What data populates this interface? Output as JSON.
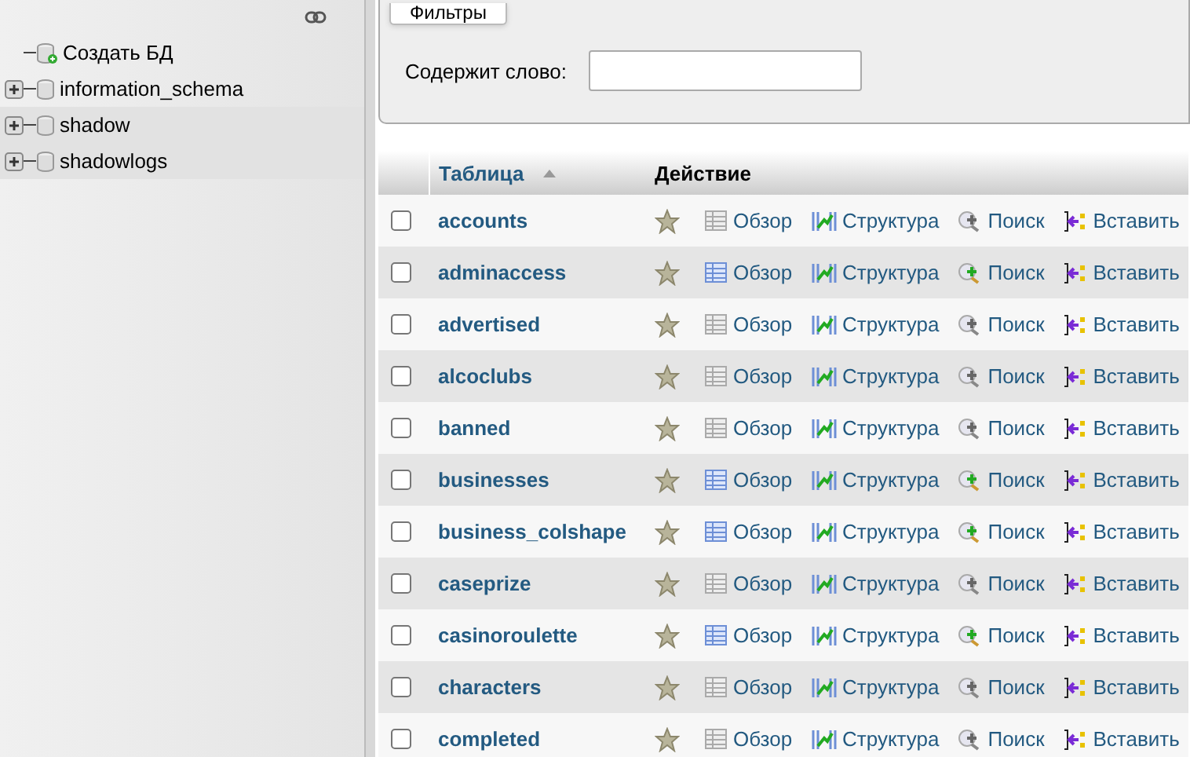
{
  "sidebar": {
    "items": [
      {
        "label": "Создать БД",
        "kind": "new",
        "expandable": false
      },
      {
        "label": "information_schema",
        "kind": "db",
        "expandable": true
      },
      {
        "label": "shadow",
        "kind": "db",
        "expandable": true
      },
      {
        "label": "shadowlogs",
        "kind": "db",
        "expandable": true
      }
    ]
  },
  "filter": {
    "button": "Фильтры",
    "label": "Содержит слово:"
  },
  "table": {
    "columns": [
      "Таблица",
      "Действие"
    ],
    "rows": [
      {
        "name": "accounts",
        "checked": false,
        "empty": true,
        "actions": [
          "Обзор",
          "Структура",
          "Поиск",
          "Вставить"
        ]
      },
      {
        "name": "adminaccess",
        "checked": false,
        "empty": false,
        "actions": [
          "Обзор",
          "Структура",
          "Поиск",
          "Вставить"
        ]
      },
      {
        "name": "advertised",
        "checked": false,
        "empty": true,
        "actions": [
          "Обзор",
          "Структура",
          "Поиск",
          "Вставить"
        ]
      },
      {
        "name": "alcoclubs",
        "checked": false,
        "empty": true,
        "actions": [
          "Обзор",
          "Структура",
          "Поиск",
          "Вставить"
        ]
      },
      {
        "name": "banned",
        "checked": false,
        "empty": true,
        "actions": [
          "Обзор",
          "Структура",
          "Поиск",
          "Вставить"
        ]
      },
      {
        "name": "businesses",
        "checked": false,
        "empty": false,
        "actions": [
          "Обзор",
          "Структура",
          "Поиск",
          "Вставить"
        ]
      },
      {
        "name": "business_colshape",
        "checked": false,
        "empty": false,
        "actions": [
          "Обзор",
          "Структура",
          "Поиск",
          "Вставить"
        ]
      },
      {
        "name": "caseprize",
        "checked": false,
        "empty": true,
        "actions": [
          "Обзор",
          "Структура",
          "Поиск",
          "Вставить"
        ]
      },
      {
        "name": "casinoroulette",
        "checked": false,
        "empty": false,
        "actions": [
          "Обзор",
          "Структура",
          "Поиск",
          "Вставить"
        ]
      },
      {
        "name": "characters",
        "checked": false,
        "empty": true,
        "actions": [
          "Обзор",
          "Структура",
          "Поиск",
          "Вставить"
        ]
      },
      {
        "name": "completed",
        "checked": false,
        "empty": true,
        "actions": [
          "Обзор",
          "Структура",
          "Поиск",
          "Вставить"
        ]
      }
    ]
  }
}
